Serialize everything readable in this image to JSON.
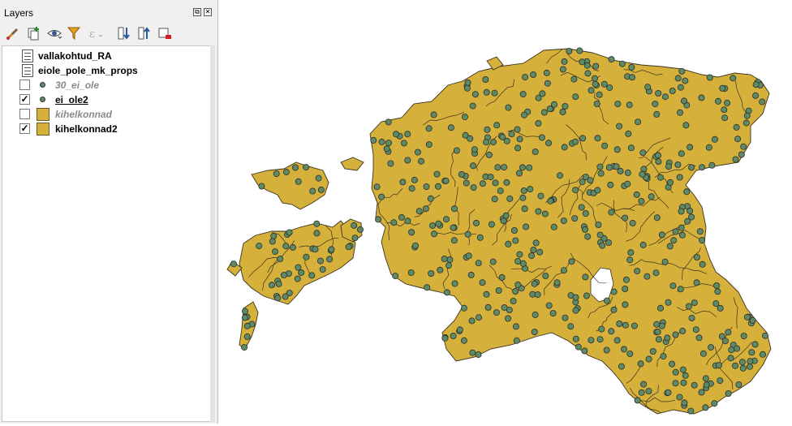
{
  "panel": {
    "title": "Layers",
    "float_glyph": "⧉",
    "close_glyph": "✕"
  },
  "toolbar": {
    "buttons": [
      {
        "icon": "style-brush-icon"
      },
      {
        "icon": "add-group-icon"
      },
      {
        "icon": "manage-visibility-eye-icon"
      },
      {
        "icon": "filter-legend-icon"
      },
      {
        "icon": "filter-expression-icon"
      },
      {
        "icon": "expand-all-icon"
      },
      {
        "icon": "collapse-all-icon"
      },
      {
        "icon": "remove-layer-icon"
      }
    ]
  },
  "layers": [
    {
      "name": "vallakohtud_RA",
      "type": "table",
      "checked": null
    },
    {
      "name": "eiole_pole_mk_props",
      "type": "table",
      "checked": null
    },
    {
      "name": "30_ei_ole",
      "type": "point",
      "checked": false
    },
    {
      "name": "ei_ole2",
      "type": "point",
      "checked": true
    },
    {
      "name": "kihelkonnad",
      "type": "polygon",
      "checked": false
    },
    {
      "name": "kihelkonnad2",
      "type": "polygon",
      "checked": true
    }
  ],
  "check_glyph": "✓",
  "map": {
    "fill_color": "#d5b03a",
    "border_color": "#3a3220",
    "point_color": "#5f8a66",
    "point_outline": "#2d2d2d",
    "background": "#ffffff"
  }
}
